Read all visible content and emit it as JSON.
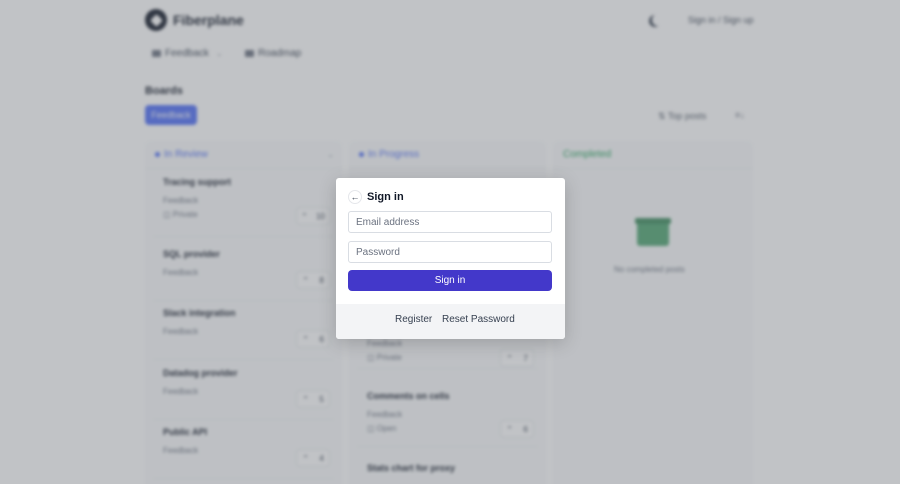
{
  "app": {
    "name": "Fiberplane"
  },
  "header": {
    "theme_icon": "moon-icon",
    "auth_links": "Sign in / Sign up"
  },
  "nav": {
    "feedback_label": "Feedback",
    "roadmap_label": "Roadmap"
  },
  "boards": {
    "title": "Boards",
    "active_board": "Feedback",
    "sort_label": "Top posts"
  },
  "columns": [
    {
      "title": "In Review",
      "color": "#4f6ef7",
      "cards": [
        {
          "title": "Tracing support",
          "tag": "Feedback",
          "status": "Private",
          "votes": "10"
        },
        {
          "title": "SQL provider",
          "tag": "Feedback",
          "status": "",
          "votes": "8"
        },
        {
          "title": "Slack integration",
          "tag": "Feedback",
          "status": "",
          "votes": "6"
        },
        {
          "title": "Datadog provider",
          "tag": "Feedback",
          "status": "",
          "votes": "5"
        },
        {
          "title": "Public API",
          "tag": "Feedback",
          "status": "",
          "votes": "4"
        }
      ]
    },
    {
      "title": "In Progress",
      "color": "#4f6ef7",
      "cards": [
        {
          "title": "",
          "tag": "Feedback",
          "status": "Private",
          "votes": "7"
        },
        {
          "title": "Comments on cells",
          "tag": "Feedback",
          "status": "Open",
          "votes": "6"
        },
        {
          "title": "Stats chart for proxy",
          "tag": "",
          "status": "",
          "votes": ""
        }
      ]
    },
    {
      "title": "Completed",
      "color": "#22a35a",
      "empty_text": "No completed posts"
    }
  ],
  "modal": {
    "title": "Sign in",
    "email_placeholder": "Email address",
    "password_placeholder": "Password",
    "submit_label": "Sign in",
    "register_label": "Register",
    "reset_label": "Reset Password"
  },
  "colors": {
    "accent": "#4338ca",
    "board_button": "#4f6ef7",
    "completed": "#22a35a"
  }
}
